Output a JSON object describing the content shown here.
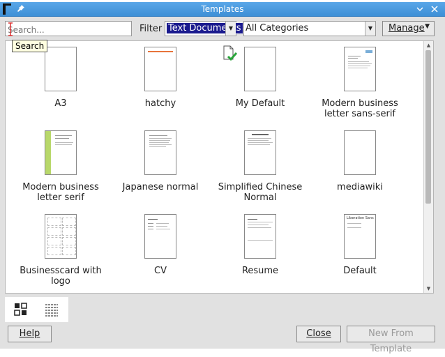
{
  "window": {
    "title": "Templates"
  },
  "toolbar": {
    "search_placeholder": "Search...",
    "filter_label": "Filter",
    "filter_value": "Text Documents",
    "category_value": "All Categories",
    "manage_label": "Manage",
    "tooltip": "Search"
  },
  "templates": [
    {
      "label": "A3"
    },
    {
      "label": "hatchy"
    },
    {
      "label": "My Default"
    },
    {
      "label": "Modern business letter sans-serif"
    },
    {
      "label": "Modern business letter serif"
    },
    {
      "label": "Japanese normal"
    },
    {
      "label": "Simplified Chinese Normal"
    },
    {
      "label": "mediawiki"
    },
    {
      "label": "Businesscard with logo"
    },
    {
      "label": "CV"
    },
    {
      "label": "Resume"
    },
    {
      "label": "Default"
    }
  ],
  "default_preview_text": "Liberation Sans",
  "buttons": {
    "help": "Help",
    "close": "Close",
    "new_from_template": "New From Template"
  },
  "colors": {
    "titlebar": "#3d8fd6",
    "accent_orange": "#e8743b",
    "accent_green": "#2aa53b",
    "selection": "#1a1a8e"
  }
}
